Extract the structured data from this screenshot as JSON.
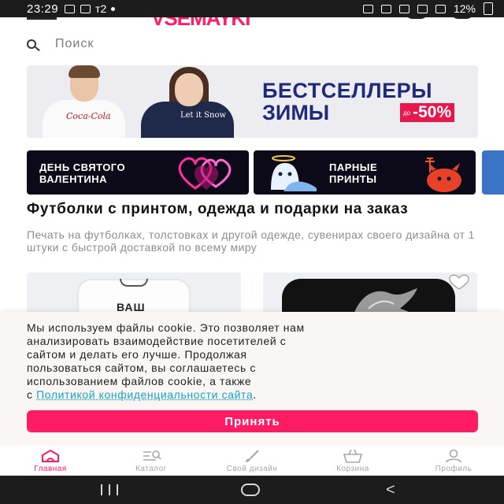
{
  "status_bar": {
    "time": "23:29",
    "network": "т2",
    "battery": "12%"
  },
  "header": {
    "logo": "VSEMAYKI"
  },
  "search": {
    "placeholder": "Поиск"
  },
  "banner": {
    "line1": "БЕСТСЕЛЛЕРЫ",
    "line2": "ЗИМЫ",
    "discount_prefix": "до",
    "discount_value": "-50%",
    "print_left": "Coca-Cola",
    "print_right": "Let it Snow"
  },
  "categories": [
    {
      "line1": "ДЕНЬ СВЯТОГО",
      "line2": "ВАЛЕНТИНА"
    },
    {
      "line1": "ПАРНЫЕ",
      "line2": "ПРИНТЫ"
    }
  ],
  "headline": "Футболки с принтом, одежда и подарки на заказ",
  "subtext": "Печать на футболках, толстовках и другой одежде, сувенирах своего дизайна от 1 штуки с быстрой доставкой по всему миру",
  "products": [
    {
      "print_text": "ВАШ"
    },
    {
      "print_text": ""
    }
  ],
  "cookie": {
    "line1": "Мы используем файлы cookie. Это позволяет нам",
    "line2": "анализировать взаимодействие посетителей с",
    "line3": "сайтом и делать его лучше. Продолжая",
    "line4": "пользоваться сайтом, вы соглашаетесь с",
    "line5": "использованием файлов cookie, а также",
    "line6_prefix": "с ",
    "policy_link": "Политикой конфиденциальности сайта",
    "line6_suffix": ".",
    "accept_label": "Принять"
  },
  "bottom_nav": [
    {
      "label": "Главная",
      "icon": "home-icon",
      "active": true
    },
    {
      "label": "Каталог",
      "icon": "catalog-icon",
      "active": false
    },
    {
      "label": "Свой дизайн",
      "icon": "brush-icon",
      "active": false
    },
    {
      "label": "Корзина",
      "icon": "basket-icon",
      "active": false
    },
    {
      "label": "Профиль",
      "icon": "profile-icon",
      "active": false
    }
  ],
  "colors": {
    "brand": "#ff1c64",
    "banner_text": "#1f2a7a",
    "link": "#17a3c7",
    "nav_inactive": "#a6a6a6"
  }
}
